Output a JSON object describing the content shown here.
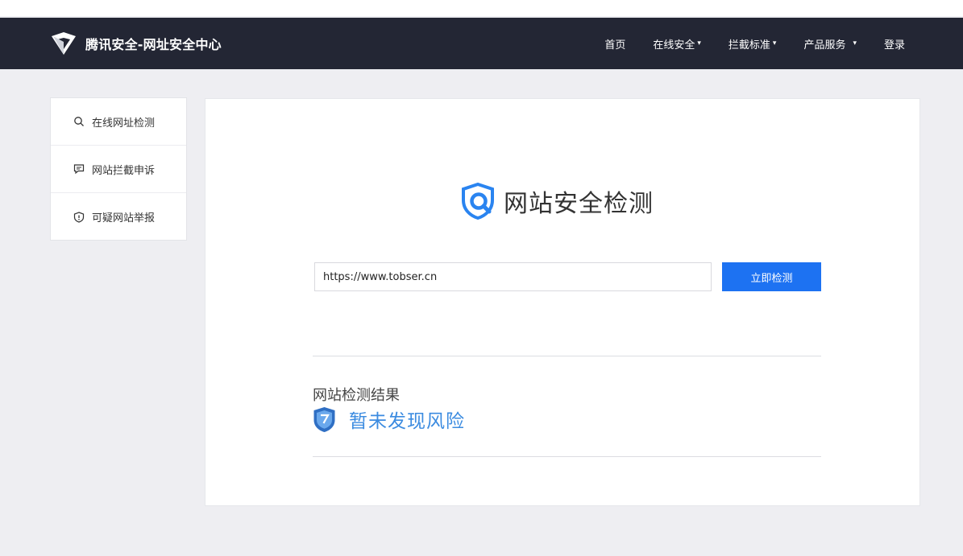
{
  "brand": {
    "name": "腾讯安全-网址安全中心"
  },
  "nav": {
    "items": [
      {
        "label": "首页",
        "dropdown": false
      },
      {
        "label": "在线安全",
        "dropdown": true
      },
      {
        "label": "拦截标准",
        "dropdown": true
      },
      {
        "label": "产品服务",
        "dropdown": true
      },
      {
        "label": "登录",
        "dropdown": false
      }
    ],
    "caret": "▾"
  },
  "sidebar": {
    "items": [
      {
        "label": "在线网址检测",
        "icon": "search-icon"
      },
      {
        "label": "网站拦截申诉",
        "icon": "comment-icon"
      },
      {
        "label": "可疑网站举报",
        "icon": "shield-alert-icon"
      }
    ]
  },
  "main": {
    "title": "网站安全检测",
    "search": {
      "value": "https://www.tobser.cn"
    },
    "button_label": "立即检测",
    "result_label": "网站检测结果",
    "result_text": "暂未发现风险"
  },
  "colors": {
    "navbar_bg": "#232634",
    "page_bg": "#eeeef2",
    "accent": "#1d72f2",
    "result_blue": "#3b8be0"
  }
}
